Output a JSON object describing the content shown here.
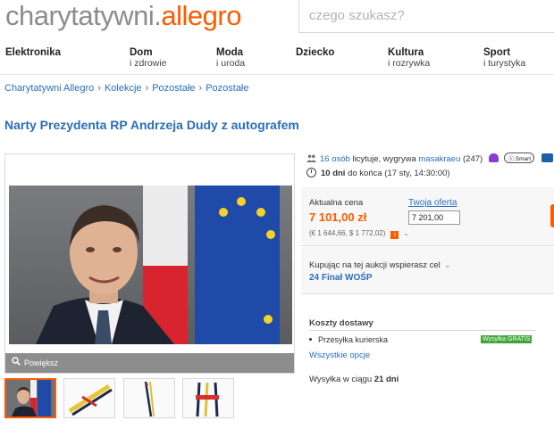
{
  "header": {
    "logo_part1": "charytatywni.",
    "logo_part2": "allegro",
    "search_placeholder": "czego szukasz?"
  },
  "nav": {
    "categories": [
      {
        "main": "Elektronika",
        "sub": ""
      },
      {
        "main": "Dom",
        "sub": "i zdrowie"
      },
      {
        "main": "Moda",
        "sub": "i uroda"
      },
      {
        "main": "Dziecko",
        "sub": ""
      },
      {
        "main": "Kultura",
        "sub": "i rozrywka"
      },
      {
        "main": "Sport",
        "sub": "i turystyka"
      }
    ]
  },
  "breadcrumb": [
    "Charytatywni Allegro",
    "Kolekcje",
    "Pozostałe",
    "Pozostałe"
  ],
  "breadcrumb_separator": "›",
  "product": {
    "title": "Narty Prezydenta RP Andrzeja Dudy z autografem"
  },
  "gallery": {
    "zoom_label": "Powiększ",
    "thumb_count": 4,
    "active_thumb": 1
  },
  "bids": {
    "bidders_count": "16 osób",
    "bidders_text": "licytuje, wygrywa",
    "leader": "masakraeu",
    "leader_rating": "(247)",
    "smart_badge": "ⓢ.Smart"
  },
  "time": {
    "days": "10 dni",
    "text": "do końca (17 sty, 14:30:00)"
  },
  "price": {
    "label": "Aktualna cena",
    "value": "7 101,00 zł",
    "converted": "(€ 1 644,66, $ 1 772,02)",
    "info_icon_label": "i",
    "offer_label": "Twoja oferta",
    "offer_value": "7 201,00"
  },
  "charity": {
    "text": "Kupując na tej aukcji wspierasz cel",
    "name": "24 Finał WOŚP"
  },
  "shipping": {
    "heading": "Koszty dostawy",
    "method": "Przesyłka kurierska",
    "free_badge": "Wysyłka GRATIS",
    "all_options": "Wszystkie opcje",
    "dispatch_text": "Wysyłka w ciągu",
    "dispatch_days": "21 dni"
  },
  "colors": {
    "accent": "#ff5a00",
    "link": "#2a6ebb",
    "free_green": "#3fa535"
  }
}
